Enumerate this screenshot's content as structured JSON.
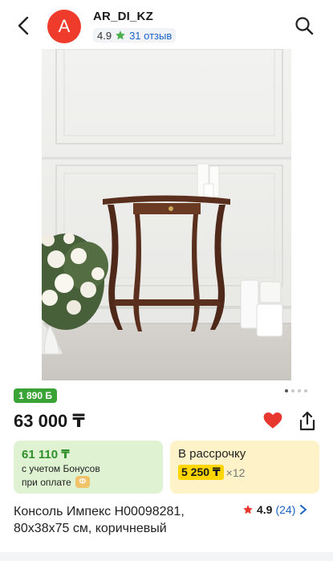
{
  "header": {
    "avatar_letter": "A",
    "store_name": "AR_DI_KZ",
    "rating": "4.9",
    "reviews": "31 отзыв"
  },
  "product": {
    "bonus_badge": "1 890 Б",
    "price": "63 000 ₸",
    "bonus_card": {
      "amount": "61 110 ₸",
      "line1": "с учетом Бонусов",
      "line2": "при оплате",
      "coin_symbol": "Ф"
    },
    "installment_card": {
      "title": "В рассрочку",
      "monthly": "5 250 ₸",
      "multiplier": "×12"
    },
    "name": "Консоль Импекс Н00098281, 80x38x75 см, коричневый",
    "rating": "4.9",
    "review_count": "(24)"
  },
  "gallery": {
    "total": 4,
    "active_index": 0
  },
  "icons": [
    "back-arrow-icon",
    "search-icon",
    "star-icon",
    "heart-icon",
    "share-icon",
    "chevron-right-icon"
  ],
  "colors": {
    "accent_red": "#ef3b2c",
    "link_blue": "#1b64c8",
    "green": "#3aa335",
    "yellow": "#ffd600"
  }
}
